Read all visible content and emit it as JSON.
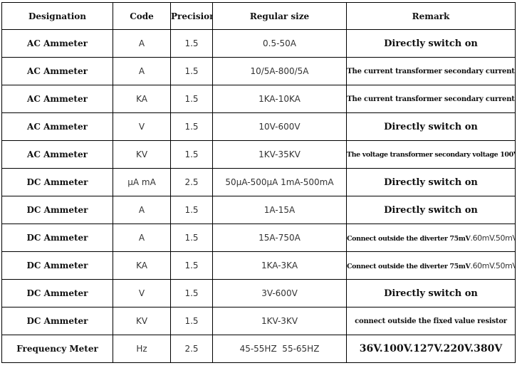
{
  "table": {
    "headers": [
      "Designation",
      "Code",
      "Precision",
      "Regular size",
      "Remark"
    ],
    "rows": [
      {
        "designation": "AC Ammeter",
        "code": "A",
        "precision": "1.5",
        "regular_size": "0.5-50A",
        "remark": "Directly switch on"
      },
      {
        "designation": "AC Ammeter",
        "code": "A",
        "precision": "1.5",
        "regular_size": "10/5A-800/5A",
        "remark": "The current transformer secondary current"
      },
      {
        "designation": "AC Ammeter",
        "code": "KA",
        "precision": "1.5",
        "regular_size": "1KA-10KA",
        "remark": "The current transformer secondary current"
      },
      {
        "designation": "AC Ammeter",
        "code": "V",
        "precision": "1.5",
        "regular_size": "10V-600V",
        "remark": "Directly switch on"
      },
      {
        "designation": "AC Ammeter",
        "code": "KV",
        "precision": "1.5",
        "regular_size": "1KV-35KV",
        "remark": "The voltage transformer secondary voltage 100V"
      },
      {
        "designation": "DC Ammeter",
        "code": "μA mA",
        "precision": "2.5",
        "regular_size": "50μA-500μA 1mA-500mA",
        "remark": "Directly switch on"
      },
      {
        "designation": "DC Ammeter",
        "code": "A",
        "precision": "1.5",
        "regular_size": "1A-15A",
        "remark": "Directly switch on"
      },
      {
        "designation": "DC Ammeter",
        "code": "A",
        "precision": "1.5",
        "regular_size": "15A-750A",
        "remark_bold": "Connect outside the diverter 75mV",
        "remark_thin": ".60mV.50mV"
      },
      {
        "designation": "DC Ammeter",
        "code": "KA",
        "precision": "1.5",
        "regular_size": "1KA-3KA",
        "remark_bold": "Connect outside the diverter 75mV",
        "remark_thin": ".60mV.50mV"
      },
      {
        "designation": "DC Ammeter",
        "code": "V",
        "precision": "1.5",
        "regular_size": "3V-600V",
        "remark": "Directly switch on"
      },
      {
        "designation": "DC Ammeter",
        "code": "KV",
        "precision": "1.5",
        "regular_size": "1KV-3KV",
        "remark": "connect outside the fixed value resistor"
      },
      {
        "designation": "Frequency Meter",
        "code": "Hz",
        "precision": "2.5",
        "regular_size": "45-55HZ  55-65HZ",
        "remark": "36V.100V.127V.220V.380V"
      }
    ]
  }
}
